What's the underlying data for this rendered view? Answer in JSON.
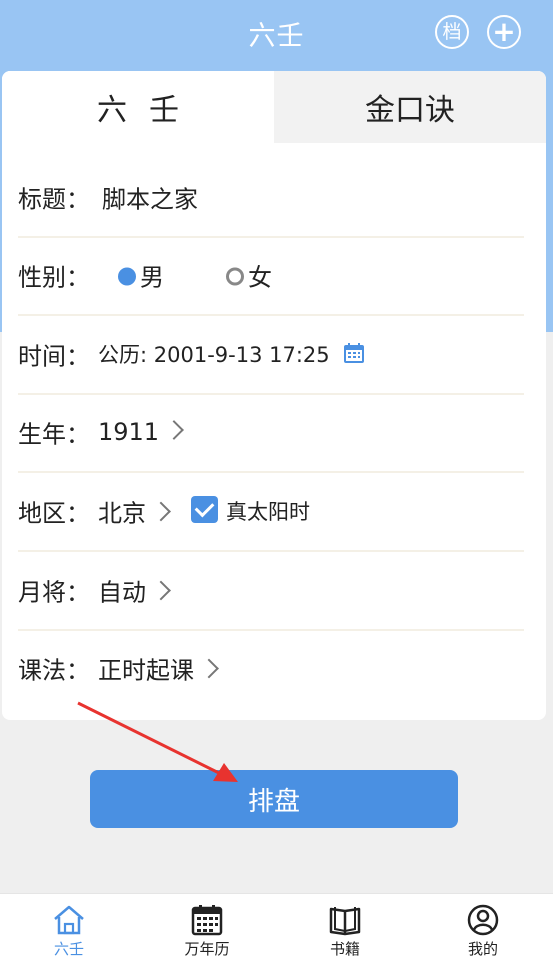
{
  "header": {
    "title": "六壬",
    "archive_label": "档",
    "add_label": "+"
  },
  "tabs": [
    {
      "label": "六壬",
      "active": true
    },
    {
      "label": "金口诀",
      "active": false
    }
  ],
  "form": {
    "title": {
      "label": "标题：",
      "value": "脚本之家"
    },
    "gender": {
      "label": "性别：",
      "options": [
        "男",
        "女"
      ],
      "selected": "男"
    },
    "time": {
      "label": "时间：",
      "value": "公历: 2001-9-13 17:25"
    },
    "birth_year": {
      "label": "生年：",
      "value": "1911"
    },
    "region": {
      "label": "地区：",
      "value": "北京",
      "solar_time_label": "真太阳时",
      "solar_time_checked": true
    },
    "month_general": {
      "label": "月将：",
      "value": "自动"
    },
    "method": {
      "label": "课法：",
      "value": "正时起课"
    }
  },
  "submit_label": "排盘",
  "nav": [
    {
      "label": "六壬",
      "icon": "home-icon",
      "active": true
    },
    {
      "label": "万年历",
      "icon": "calendar-icon",
      "active": false
    },
    {
      "label": "书籍",
      "icon": "book-icon",
      "active": false
    },
    {
      "label": "我的",
      "icon": "user-icon",
      "active": false
    }
  ],
  "colors": {
    "header_bg": "#99c5f3",
    "accent": "#4a90e2",
    "page_bg": "#efefef",
    "annotation_arrow": "#e8332f"
  }
}
